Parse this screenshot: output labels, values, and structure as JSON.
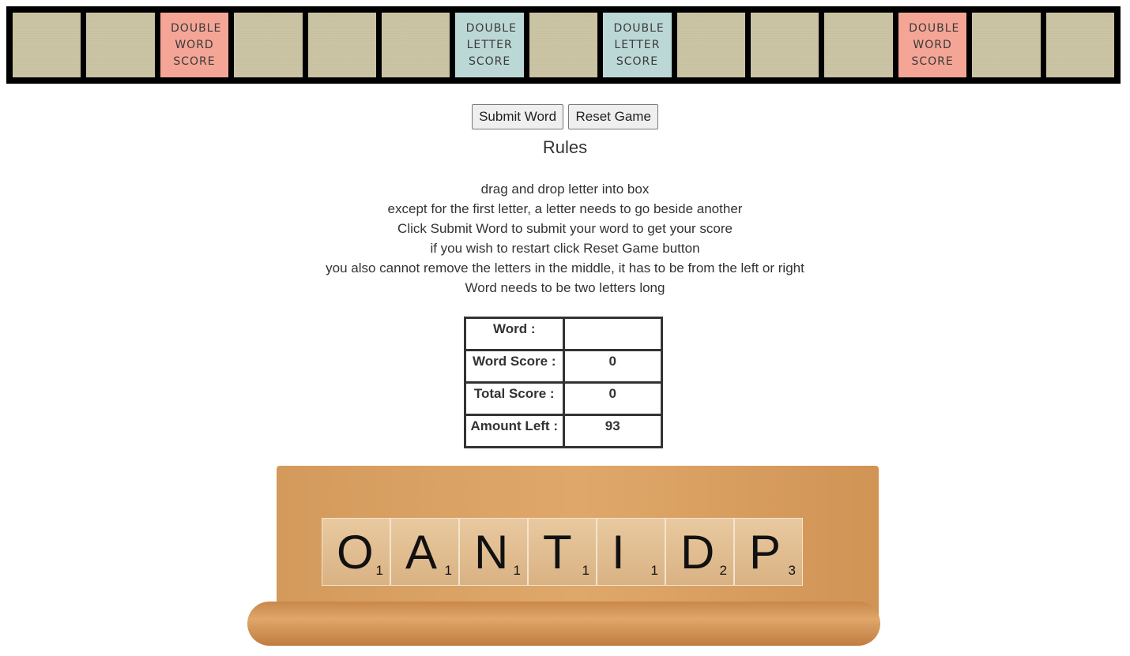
{
  "board": {
    "squares": [
      {
        "type": "normal",
        "label": ""
      },
      {
        "type": "normal",
        "label": ""
      },
      {
        "type": "dw",
        "label": "DOUBLE WORD SCORE"
      },
      {
        "type": "normal",
        "label": ""
      },
      {
        "type": "normal",
        "label": ""
      },
      {
        "type": "normal",
        "label": ""
      },
      {
        "type": "dl",
        "label": "DOUBLE LETTER SCORE"
      },
      {
        "type": "normal",
        "label": ""
      },
      {
        "type": "dl",
        "label": "DOUBLE LETTER SCORE"
      },
      {
        "type": "normal",
        "label": ""
      },
      {
        "type": "normal",
        "label": ""
      },
      {
        "type": "normal",
        "label": ""
      },
      {
        "type": "dw",
        "label": "DOUBLE WORD SCORE"
      },
      {
        "type": "normal",
        "label": ""
      },
      {
        "type": "normal",
        "label": ""
      }
    ]
  },
  "buttons": {
    "submit": "Submit Word",
    "reset": "Reset Game"
  },
  "rules": {
    "title": "Rules",
    "lines": [
      "drag and drop letter into box",
      "except for the first letter, a letter needs to go beside another",
      "Click Submit Word to submit your word to get your score",
      "if you wish to restart click Reset Game button",
      "you also cannot remove the letters in the middle, it has to be from the left or right",
      "Word needs to be two letters long"
    ]
  },
  "score": {
    "rows": [
      {
        "label": "Word :",
        "value": ""
      },
      {
        "label": "Word Score :",
        "value": "0"
      },
      {
        "label": "Total Score :",
        "value": "0"
      },
      {
        "label": "Amount Left :",
        "value": "93"
      }
    ]
  },
  "rack": {
    "tiles": [
      {
        "letter": "O",
        "value": "1"
      },
      {
        "letter": "A",
        "value": "1"
      },
      {
        "letter": "N",
        "value": "1"
      },
      {
        "letter": "T",
        "value": "1"
      },
      {
        "letter": "I",
        "value": "1"
      },
      {
        "letter": "D",
        "value": "2"
      },
      {
        "letter": "P",
        "value": "3"
      }
    ]
  }
}
